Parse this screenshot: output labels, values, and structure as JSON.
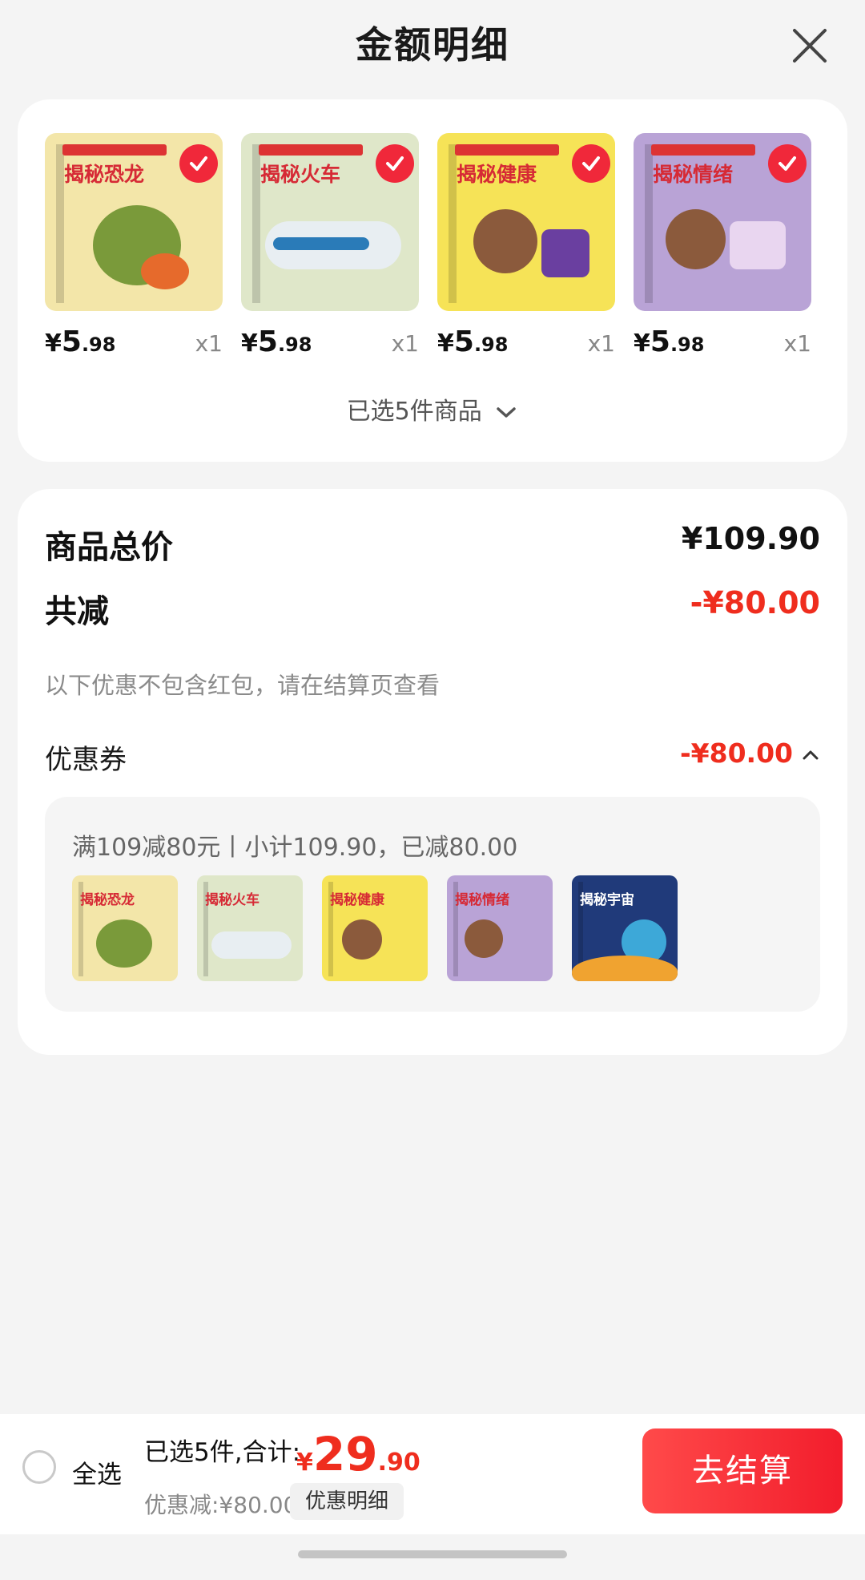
{
  "header": {
    "title": "金额明细"
  },
  "products": [
    {
      "cover_title": "揭秘恐龙",
      "price_symbol": "¥",
      "price_int": "5",
      "price_dec": ".98",
      "qty": "x1",
      "color": "#f3e6a9"
    },
    {
      "cover_title": "揭秘火车",
      "price_symbol": "¥",
      "price_int": "5",
      "price_dec": ".98",
      "qty": "x1",
      "color": "#dfe7c9"
    },
    {
      "cover_title": "揭秘健康",
      "price_symbol": "¥",
      "price_int": "5",
      "price_dec": ".98",
      "qty": "x1",
      "color": "#f6e357"
    },
    {
      "cover_title": "揭秘情绪",
      "price_symbol": "¥",
      "price_int": "5",
      "price_dec": ".98",
      "qty": "x1",
      "color": "#b9a3d6"
    }
  ],
  "selected_count_label": "已选5件商品",
  "summary": {
    "total_label": "商品总价",
    "total_value": "¥109.90",
    "reduce_label": "共减",
    "reduce_value": "-¥80.00",
    "note": "以下优惠不包含红包，请在结算页查看",
    "coupon_label": "优惠券",
    "coupon_value": "-¥80.00"
  },
  "coupon_detail": {
    "desc": "满109减80元丨小计109.90，已减80.00",
    "books": [
      {
        "title": "揭秘恐龙",
        "color": "#f3e6a9"
      },
      {
        "title": "揭秘火车",
        "color": "#dfe7c9"
      },
      {
        "title": "揭秘健康",
        "color": "#f6e357"
      },
      {
        "title": "揭秘情绪",
        "color": "#b9a3d6"
      },
      {
        "title": "揭秘宇宙",
        "color": "#203a7a"
      }
    ]
  },
  "bottom": {
    "select_all": "全选",
    "summary": "已选5件,合计:",
    "total_symbol": "¥",
    "total_int": "29",
    "total_dec": ".90",
    "discount": "优惠减:¥80.00",
    "detail_btn": "优惠明细",
    "checkout": "去结算"
  },
  "colors": {
    "accent": "#ef2d1e",
    "check": "#f0283a"
  }
}
